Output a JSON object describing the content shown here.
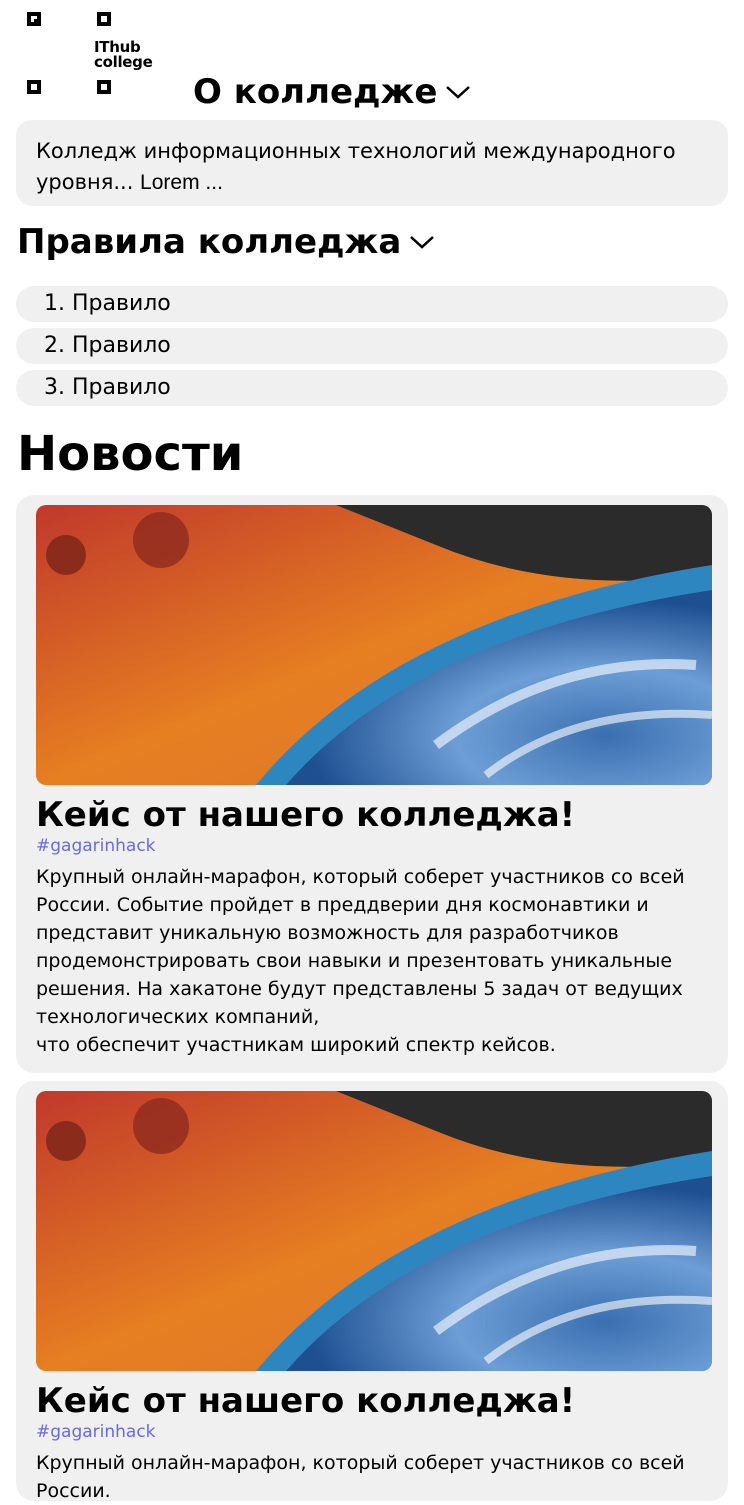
{
  "logo": {
    "line1": "IThub",
    "line2": "college"
  },
  "about": {
    "title": "О колледже",
    "text": "Колледж информационных технологий международного уровня... ",
    "lorem": "Lorem ..."
  },
  "rules": {
    "title": "Правила колледжа",
    "items": [
      "1. Правило",
      "2. Правило",
      "3. Правило"
    ]
  },
  "news": {
    "title": "Новости",
    "items": [
      {
        "title": "Кейс от нашего колледжа!",
        "tag": "#gagarinhack",
        "text": "Крупный онлайн-марафон, который соберет участников со всей России. Событие пройдет в преддверии дня космонавтики и представит уникальную возможность для разработчиков продемонстрировать свои навыки и презентовать уникальные решения. На хакатоне будут представлены 5 задач от ведущих технологических компаний,\nчто обеспечит участникам широкий спектр кейсов."
      },
      {
        "title": "Кейс от нашего колледжа!",
        "tag": "#gagarinhack",
        "text": "Крупный онлайн-марафон, который соберет участников со всей России."
      }
    ]
  },
  "colors": {
    "card_bg": "#f0f0f0",
    "tag": "#6a6ae0"
  }
}
